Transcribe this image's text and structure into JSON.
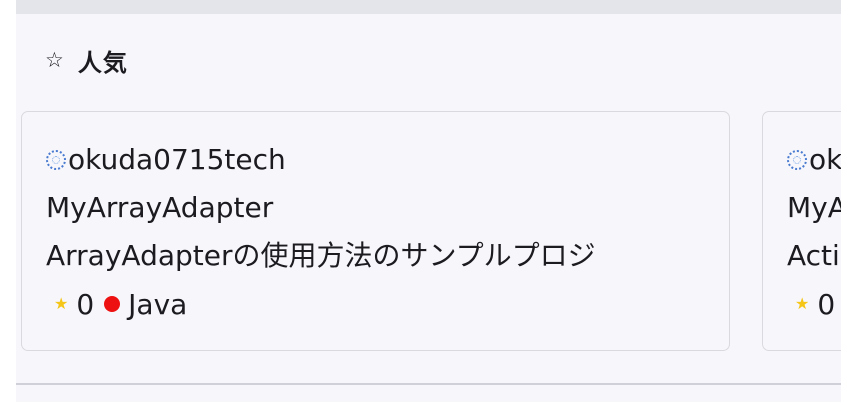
{
  "section": {
    "icon": "star-outline-icon",
    "icon_glyph": "☆",
    "title": "人気"
  },
  "cards": [
    {
      "owner": "okuda0715tech",
      "name": "MyArrayAdapter",
      "description": "ArrayAdapterの使用方法のサンプルプロジ",
      "stars": "0",
      "star_glyph": "★",
      "language": "Java",
      "language_color": "#ee1111"
    },
    {
      "owner": "ok",
      "name": "MyA",
      "description": "Acti",
      "stars": "0",
      "star_glyph": "★"
    }
  ],
  "colors": {
    "panel_bg": "#f7f7fb",
    "top_band": "#e3e5eb",
    "card_border": "#d9d9df",
    "star": "#f5c518",
    "text": "#1c1b1f"
  }
}
